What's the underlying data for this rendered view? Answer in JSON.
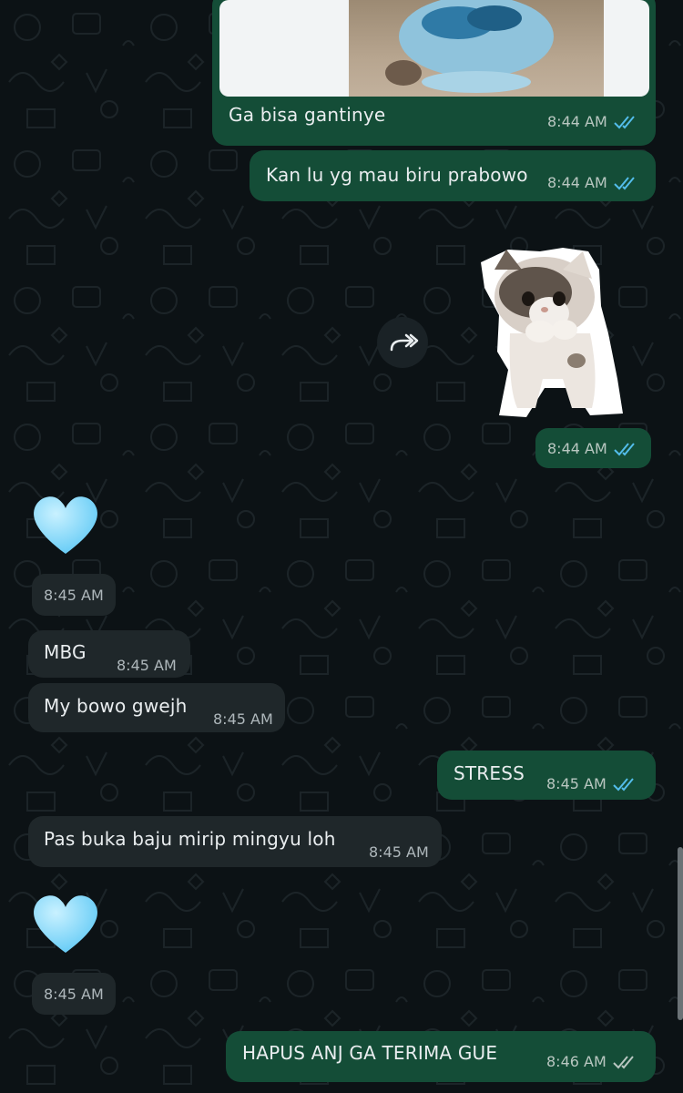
{
  "colors": {
    "outgoing_bubble": "#144d37",
    "incoming_bubble": "#1f272a",
    "read_ticks": "#53bdeb",
    "sent_ticks": "#b9c7c1",
    "background": "#0c1215"
  },
  "messages": [
    {
      "direction": "outgoing",
      "type": "image-with-caption",
      "text": "Ga bisa gantinye",
      "time": "8:44 AM",
      "status": "read"
    },
    {
      "direction": "outgoing",
      "type": "text",
      "text": "Kan lu yg mau biru prabowo",
      "time": "8:44 AM",
      "status": "read"
    },
    {
      "direction": "outgoing",
      "type": "sticker",
      "sticker": "dancing-kitten-sticker",
      "time": "8:44 AM",
      "status": "read"
    },
    {
      "direction": "incoming",
      "type": "emoji",
      "emoji": "light-blue-heart",
      "time": "8:45 AM"
    },
    {
      "direction": "incoming",
      "type": "text",
      "text": "MBG",
      "time": "8:45 AM"
    },
    {
      "direction": "incoming",
      "type": "text",
      "text": "My bowo gwejh",
      "time": "8:45 AM"
    },
    {
      "direction": "outgoing",
      "type": "text",
      "text": "STRESS",
      "time": "8:45 AM",
      "status": "read"
    },
    {
      "direction": "incoming",
      "type": "text",
      "text": "Pas buka baju mirip mingyu loh",
      "time": "8:45 AM"
    },
    {
      "direction": "incoming",
      "type": "emoji",
      "emoji": "light-blue-heart",
      "time": "8:45 AM"
    },
    {
      "direction": "outgoing",
      "type": "text",
      "text": "HAPUS ANJ GA TERIMA GUE",
      "time": "8:46 AM",
      "status": "delivered"
    }
  ],
  "forward_button": {
    "icon": "forward-icon"
  }
}
